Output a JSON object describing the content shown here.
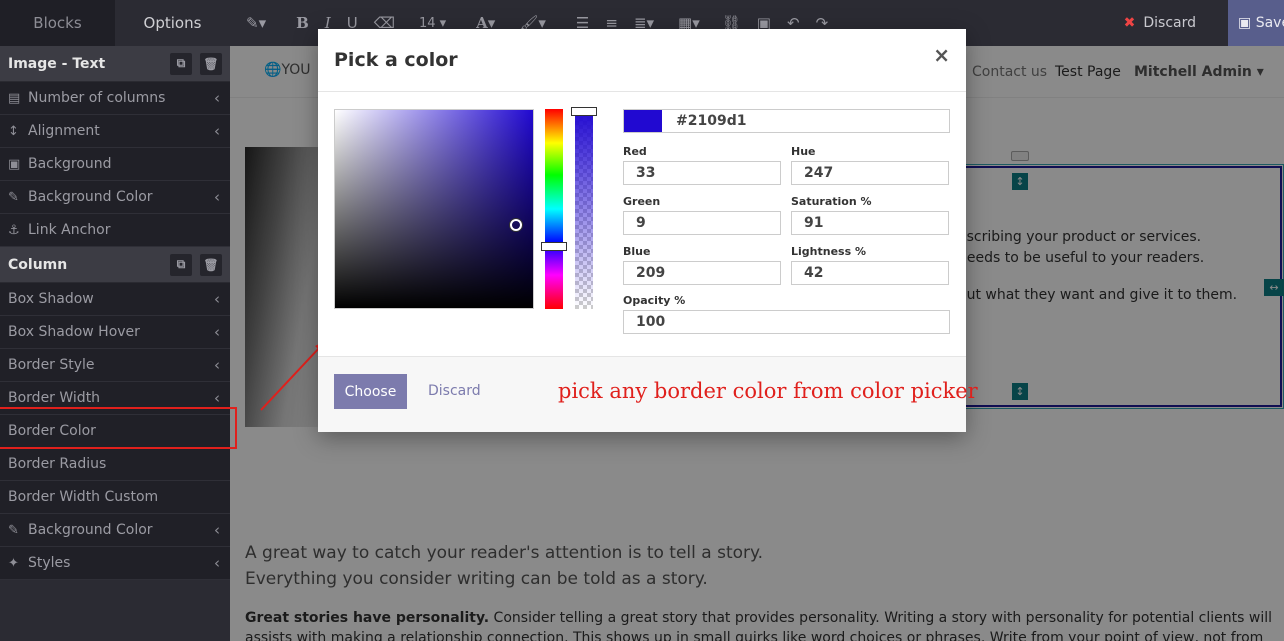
{
  "sidebar": {
    "tabs": [
      "Blocks",
      "Options"
    ],
    "sections": [
      {
        "title": "Image - Text",
        "options": [
          {
            "icon": "columns-icon",
            "glyph": "▤",
            "label": "Number of columns",
            "chevron": true
          },
          {
            "icon": "alignment-icon",
            "glyph": "↕",
            "label": "Alignment",
            "chevron": true
          },
          {
            "icon": "image-icon",
            "glyph": "▣",
            "label": "Background",
            "chevron": false
          },
          {
            "icon": "eyedropper-icon",
            "glyph": "✎",
            "label": "Background Color",
            "chevron": true
          },
          {
            "icon": "anchor-icon",
            "glyph": "⚓",
            "label": "Link Anchor",
            "chevron": false
          }
        ]
      },
      {
        "title": "Column",
        "options": [
          {
            "label": "Box Shadow",
            "chevron": true
          },
          {
            "label": "Box Shadow Hover",
            "chevron": true
          },
          {
            "label": "Border Style",
            "chevron": true
          },
          {
            "label": "Border Width",
            "chevron": true
          },
          {
            "label": "Border Color",
            "chevron": false
          },
          {
            "label": "Border Radius",
            "chevron": false
          },
          {
            "label": "Border Width Custom",
            "chevron": false
          },
          {
            "icon": "eyedropper-icon",
            "glyph": "✎",
            "label": "Background Color",
            "chevron": true
          },
          {
            "icon": "magic-icon",
            "glyph": "✦",
            "label": "Styles",
            "chevron": true
          }
        ]
      }
    ]
  },
  "toolbar": {
    "font_size": "14",
    "discard_label": "Discard",
    "save_label": "Save"
  },
  "site": {
    "logo_text": "YOU",
    "nav_links": [
      "Contact us",
      "Test Page"
    ],
    "user": "Mitchell Admin",
    "heading_fragment": "e",
    "body_fragments": [
      "escribing your product or services.",
      "needs to be useful to your readers.",
      "out what they want and give it to them."
    ],
    "story_lines": [
      "A great way to catch your reader's attention is to tell a story.",
      "Everything you consider writing can be told as a story."
    ],
    "paragraph_bold": "Great stories have personality.",
    "paragraph_text": " Consider telling a great story that provides personality. Writing a story with personality for potential clients will assists with making a relationship connection. This shows up in small quirks like word choices or phrases. Write from your point of view, not from someone else's experience."
  },
  "modal": {
    "title": "Pick a color",
    "hex": "#2109d1",
    "fields": {
      "red": {
        "label": "Red",
        "value": "33"
      },
      "green": {
        "label": "Green",
        "value": "9"
      },
      "blue": {
        "label": "Blue",
        "value": "209"
      },
      "hue": {
        "label": "Hue",
        "value": "247"
      },
      "saturation": {
        "label": "Saturation %",
        "value": "91"
      },
      "lightness": {
        "label": "Lightness %",
        "value": "42"
      },
      "opacity": {
        "label": "Opacity %",
        "value": "100"
      }
    },
    "choose_label": "Choose",
    "discard_label": "Discard"
  },
  "annotation": "pick any border color from color picker",
  "colors": {
    "selected": "#2109d1",
    "annotation_red": "#e0201c",
    "primary_button": "#7c7bad"
  }
}
